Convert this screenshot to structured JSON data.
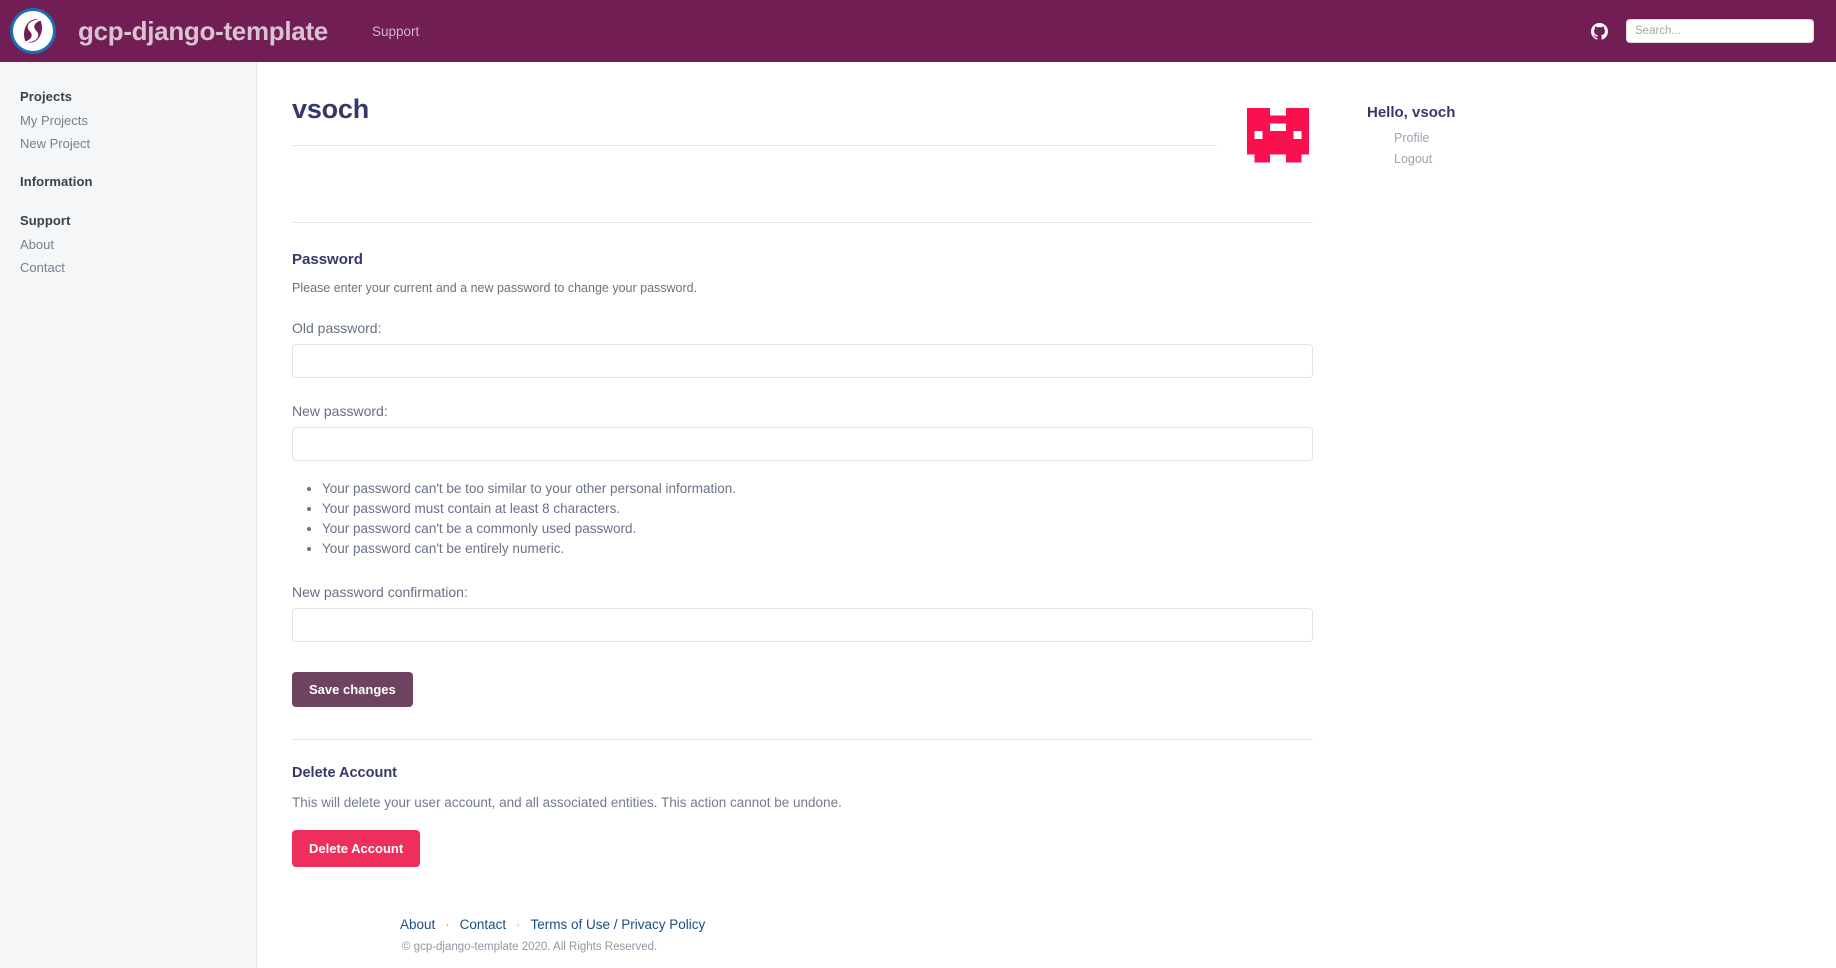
{
  "header": {
    "logo_icon": "swirl-s-logo-icon",
    "brand_title": "gcp-django-template",
    "nav_links": [
      {
        "label": "Support"
      }
    ],
    "github_icon": "github-icon",
    "search": {
      "placeholder": "Search...",
      "value": ""
    },
    "background_color": "#711e55"
  },
  "sidebar": {
    "groups": [
      {
        "heading": "Projects",
        "items": [
          {
            "label": "My Projects"
          },
          {
            "label": "New Project"
          }
        ]
      },
      {
        "heading": "Information",
        "items": []
      },
      {
        "heading": "Support",
        "items": [
          {
            "label": "About"
          },
          {
            "label": "Contact"
          }
        ]
      }
    ]
  },
  "profile": {
    "username": "vsoch",
    "avatar_icon": "identicon-avatar",
    "avatar_color": "#f9104f",
    "greeting": "Hello, vsoch",
    "menu": [
      {
        "label": "Profile"
      },
      {
        "label": "Logout"
      }
    ]
  },
  "password_section": {
    "title": "Password",
    "description": "Please enter your current and a new password to change your password.",
    "fields": [
      {
        "label": "Old password:",
        "value": "",
        "placeholder": ""
      },
      {
        "label": "New password:",
        "value": "",
        "placeholder": ""
      }
    ],
    "help_text": [
      "Your password can't be too similar to your other personal information.",
      "Your password must contain at least 8 characters.",
      "Your password can't be a commonly used password.",
      "Your password can't be entirely numeric."
    ],
    "confirm_field": {
      "label": "New password confirmation:",
      "value": "",
      "placeholder": ""
    },
    "save_label": "Save changes",
    "save_color": "#6e4360"
  },
  "delete_section": {
    "title": "Delete Account",
    "description": "This will delete your user account, and all associated entities. This action cannot be undone.",
    "button_label": "Delete Account",
    "button_color": "#ee2f5b"
  },
  "footer": {
    "links": [
      {
        "label": "About"
      },
      {
        "label": "Contact"
      },
      {
        "label": "Terms of Use / Privacy Policy"
      }
    ],
    "separator": "·",
    "copyright": "© gcp-django-template 2020. All Rights Reserved."
  }
}
